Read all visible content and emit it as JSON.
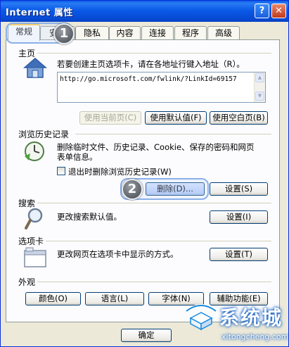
{
  "window": {
    "title": "Internet 属性"
  },
  "titlebar": {
    "help_label": "?",
    "close_label": "✕"
  },
  "tabs": [
    {
      "label": "常规"
    },
    {
      "label": "安全"
    },
    {
      "label": "隐私"
    },
    {
      "label": "内容"
    },
    {
      "label": "连接"
    },
    {
      "label": "程序"
    },
    {
      "label": "高级"
    }
  ],
  "homepage": {
    "title": "主页",
    "description": "若要创建主页选项卡，请在各地址行键入地址（R）。",
    "url": "http://go.microsoft.com/fwlink/?LinkId=69157",
    "btn_current": "使用当前页(C)",
    "btn_default": "使用默认值(F)",
    "btn_blank": "使用空白页(B)"
  },
  "history": {
    "title": "浏览历史记录",
    "desc_line1": "删除临时文件、历史记录、Cookie、保存的密码和网页",
    "desc_line2": "表单信息。",
    "checkbox_label": "退出时删除浏览历史记录(W)",
    "btn_delete": "删除(D)...",
    "btn_settings": "设置(S)"
  },
  "search": {
    "title": "搜索",
    "description": "更改搜索默认值。",
    "btn_settings": "设置(I)"
  },
  "tabs_section": {
    "title": "选项卡",
    "description": "更改网页在选项卡中显示的方式。",
    "btn_settings": "设置(T)"
  },
  "appearance": {
    "title": "外观",
    "btn_colors": "颜色(O)",
    "btn_languages": "语言(L)",
    "btn_fonts": "字体(N)",
    "btn_accessibility": "辅助功能(E)"
  },
  "footer": {
    "btn_ok": "确定"
  },
  "annotations": {
    "badge1": "1",
    "badge2": "2"
  },
  "watermark": {
    "logo_text": "系统城",
    "url": "xitongcheng.com"
  }
}
